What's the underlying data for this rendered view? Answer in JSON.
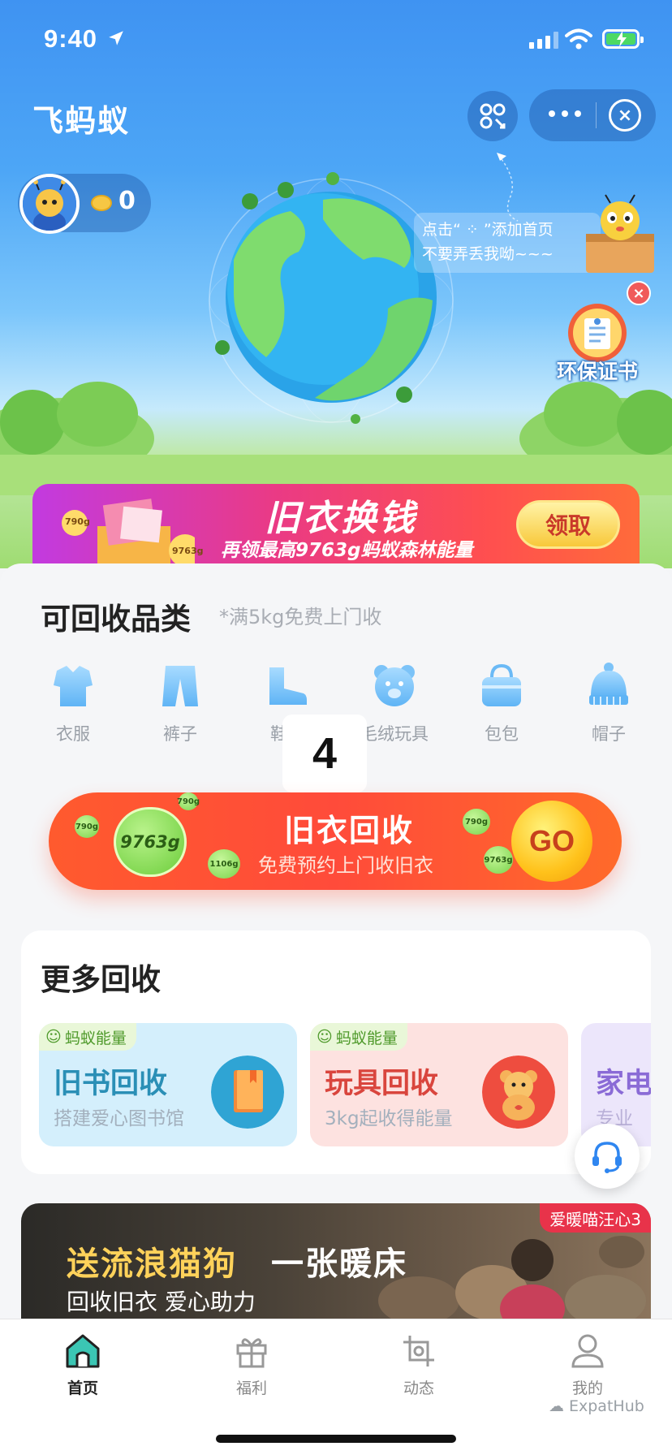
{
  "status": {
    "time": "9:40"
  },
  "header": {
    "title": "飞蚂蚁"
  },
  "user": {
    "coins": "0"
  },
  "tip": {
    "line1": "点击“ ⁘ ”添加首页",
    "line2": "不要弄丢我呦~~~"
  },
  "certificate": {
    "label": "环保证书"
  },
  "banner": {
    "title": "旧衣换钱",
    "subtitle": "再领最高9763g蚂蚁森林能量",
    "button": "领取",
    "badges": [
      "790g",
      "9763g"
    ]
  },
  "categories": {
    "title": "可回收品类",
    "note": "*满5kg免费上门收",
    "items": [
      {
        "label": "衣服",
        "icon": "shirt-icon"
      },
      {
        "label": "裤子",
        "icon": "pants-icon"
      },
      {
        "label": "鞋子",
        "icon": "shoe-icon"
      },
      {
        "label": "毛绒玩具",
        "icon": "bear-icon"
      },
      {
        "label": "包包",
        "icon": "bag-icon"
      },
      {
        "label": "帽子",
        "icon": "hat-icon"
      }
    ]
  },
  "overlay_number": "4",
  "recycle": {
    "title": "旧衣回收",
    "subtitle": "免费预约上门收旧衣",
    "go": "GO",
    "energy": "9763g",
    "mini": [
      "790g",
      "1106g",
      "790g",
      "9763g",
      "790g"
    ]
  },
  "more": {
    "title": "更多回收",
    "cards": [
      {
        "tag": "蚂蚁能量",
        "title": "旧书回收",
        "subtitle": "搭建爱心图书馆",
        "color": "#2a8fb6"
      },
      {
        "tag": "蚂蚁能量",
        "title": "玩具回收",
        "subtitle": "3kg起收得能量",
        "color": "#d9453d"
      },
      {
        "title": "家电",
        "subtitle": "专业"
      }
    ]
  },
  "promo": {
    "tag": "爱暖喵汪心3",
    "title_a": "送流浪猫狗",
    "title_b": "一张暖床",
    "subtitle": "回收旧衣  爱心助力"
  },
  "tabs": [
    {
      "label": "首页",
      "icon": "home-icon",
      "active": true
    },
    {
      "label": "福利",
      "icon": "gift-icon",
      "active": false
    },
    {
      "label": "动态",
      "icon": "crop-icon",
      "active": false
    },
    {
      "label": "我的",
      "icon": "user-icon",
      "active": false
    }
  ],
  "watermark": "ExpatHub",
  "colors": {
    "primary_blue": "#3f93f2",
    "accent_red": "#ff4b3a",
    "energy_green": "#6ccd3b"
  }
}
